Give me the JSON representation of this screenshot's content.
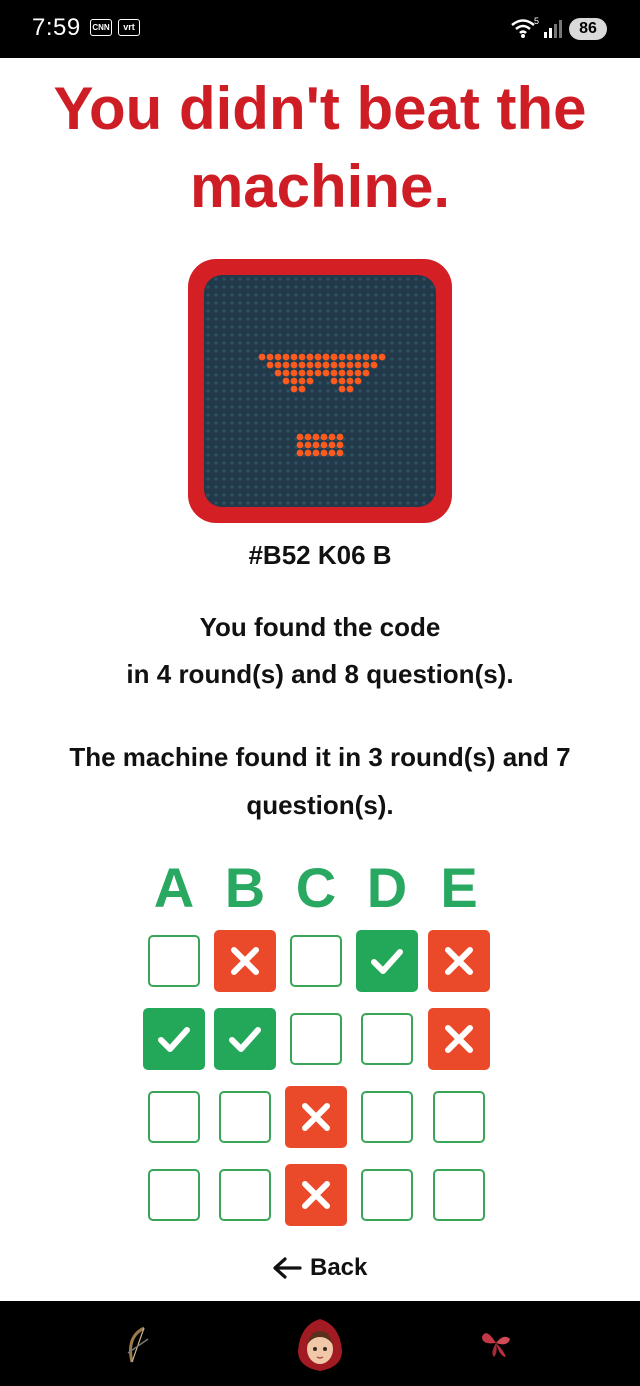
{
  "status_bar": {
    "time": "7:59",
    "notif_icons": [
      "cnn-icon",
      "vrt-nws-icon"
    ],
    "notif_labels": [
      "CNN",
      "vrt"
    ],
    "wifi_label": "5",
    "battery": "86"
  },
  "headline": {
    "line1": "You didn't beat the",
    "line2": "machine."
  },
  "robot": {
    "icon": "angry-robot-face-icon",
    "frame_color": "#d41f24",
    "led_color": "#ff5a1e"
  },
  "code_label": "#B52 K06 B",
  "player_result": {
    "line1": "You found the code",
    "line2_prefix": "in ",
    "rounds": "4",
    "line2_mid": " round(s) and ",
    "questions": "8",
    "line2_suffix": " question(s)."
  },
  "machine_result": {
    "prefix": "The machine found it in ",
    "rounds": "3",
    "mid": " round(s) and ",
    "questions": "7",
    "suffix": " question(s)."
  },
  "grid": {
    "columns": [
      "A",
      "B",
      "C",
      "D",
      "E"
    ],
    "rows": [
      [
        "empty",
        "wrong",
        "empty",
        "correct",
        "wrong"
      ],
      [
        "correct",
        "correct",
        "empty",
        "empty",
        "wrong"
      ],
      [
        "empty",
        "empty",
        "wrong",
        "empty",
        "empty"
      ],
      [
        "empty",
        "empty",
        "wrong",
        "empty",
        "empty"
      ]
    ],
    "colors": {
      "correct": "#23a859",
      "wrong": "#ea4a2a",
      "border": "#39a657",
      "header": "#28a860"
    }
  },
  "back": {
    "label": "Back",
    "icon": "arrow-left-icon"
  },
  "bottom_nav": {
    "items": [
      {
        "icon": "bow-icon"
      },
      {
        "icon": "red-riding-hood-avatar-icon"
      },
      {
        "icon": "butterfly-icon"
      }
    ]
  }
}
